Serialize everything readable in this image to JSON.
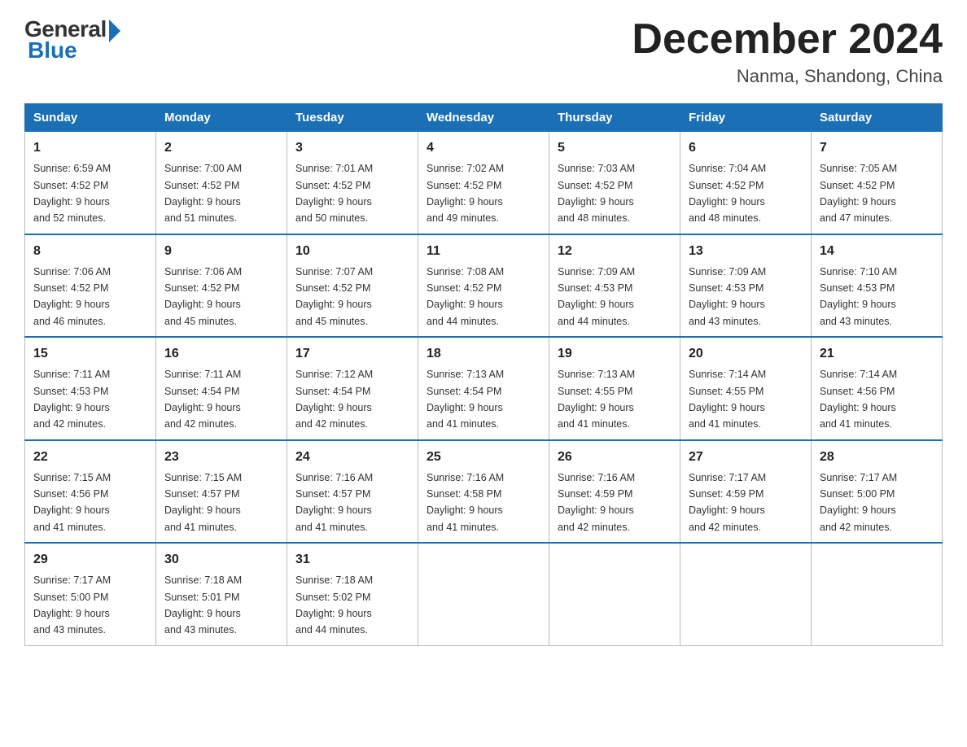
{
  "header": {
    "logo_general": "General",
    "logo_blue": "Blue",
    "month_title": "December 2024",
    "location": "Nanma, Shandong, China"
  },
  "weekdays": [
    "Sunday",
    "Monday",
    "Tuesday",
    "Wednesday",
    "Thursday",
    "Friday",
    "Saturday"
  ],
  "weeks": [
    [
      {
        "day": "1",
        "sunrise": "6:59 AM",
        "sunset": "4:52 PM",
        "daylight": "9 hours and 52 minutes."
      },
      {
        "day": "2",
        "sunrise": "7:00 AM",
        "sunset": "4:52 PM",
        "daylight": "9 hours and 51 minutes."
      },
      {
        "day": "3",
        "sunrise": "7:01 AM",
        "sunset": "4:52 PM",
        "daylight": "9 hours and 50 minutes."
      },
      {
        "day": "4",
        "sunrise": "7:02 AM",
        "sunset": "4:52 PM",
        "daylight": "9 hours and 49 minutes."
      },
      {
        "day": "5",
        "sunrise": "7:03 AM",
        "sunset": "4:52 PM",
        "daylight": "9 hours and 48 minutes."
      },
      {
        "day": "6",
        "sunrise": "7:04 AM",
        "sunset": "4:52 PM",
        "daylight": "9 hours and 48 minutes."
      },
      {
        "day": "7",
        "sunrise": "7:05 AM",
        "sunset": "4:52 PM",
        "daylight": "9 hours and 47 minutes."
      }
    ],
    [
      {
        "day": "8",
        "sunrise": "7:06 AM",
        "sunset": "4:52 PM",
        "daylight": "9 hours and 46 minutes."
      },
      {
        "day": "9",
        "sunrise": "7:06 AM",
        "sunset": "4:52 PM",
        "daylight": "9 hours and 45 minutes."
      },
      {
        "day": "10",
        "sunrise": "7:07 AM",
        "sunset": "4:52 PM",
        "daylight": "9 hours and 45 minutes."
      },
      {
        "day": "11",
        "sunrise": "7:08 AM",
        "sunset": "4:52 PM",
        "daylight": "9 hours and 44 minutes."
      },
      {
        "day": "12",
        "sunrise": "7:09 AM",
        "sunset": "4:53 PM",
        "daylight": "9 hours and 44 minutes."
      },
      {
        "day": "13",
        "sunrise": "7:09 AM",
        "sunset": "4:53 PM",
        "daylight": "9 hours and 43 minutes."
      },
      {
        "day": "14",
        "sunrise": "7:10 AM",
        "sunset": "4:53 PM",
        "daylight": "9 hours and 43 minutes."
      }
    ],
    [
      {
        "day": "15",
        "sunrise": "7:11 AM",
        "sunset": "4:53 PM",
        "daylight": "9 hours and 42 minutes."
      },
      {
        "day": "16",
        "sunrise": "7:11 AM",
        "sunset": "4:54 PM",
        "daylight": "9 hours and 42 minutes."
      },
      {
        "day": "17",
        "sunrise": "7:12 AM",
        "sunset": "4:54 PM",
        "daylight": "9 hours and 42 minutes."
      },
      {
        "day": "18",
        "sunrise": "7:13 AM",
        "sunset": "4:54 PM",
        "daylight": "9 hours and 41 minutes."
      },
      {
        "day": "19",
        "sunrise": "7:13 AM",
        "sunset": "4:55 PM",
        "daylight": "9 hours and 41 minutes."
      },
      {
        "day": "20",
        "sunrise": "7:14 AM",
        "sunset": "4:55 PM",
        "daylight": "9 hours and 41 minutes."
      },
      {
        "day": "21",
        "sunrise": "7:14 AM",
        "sunset": "4:56 PM",
        "daylight": "9 hours and 41 minutes."
      }
    ],
    [
      {
        "day": "22",
        "sunrise": "7:15 AM",
        "sunset": "4:56 PM",
        "daylight": "9 hours and 41 minutes."
      },
      {
        "day": "23",
        "sunrise": "7:15 AM",
        "sunset": "4:57 PM",
        "daylight": "9 hours and 41 minutes."
      },
      {
        "day": "24",
        "sunrise": "7:16 AM",
        "sunset": "4:57 PM",
        "daylight": "9 hours and 41 minutes."
      },
      {
        "day": "25",
        "sunrise": "7:16 AM",
        "sunset": "4:58 PM",
        "daylight": "9 hours and 41 minutes."
      },
      {
        "day": "26",
        "sunrise": "7:16 AM",
        "sunset": "4:59 PM",
        "daylight": "9 hours and 42 minutes."
      },
      {
        "day": "27",
        "sunrise": "7:17 AM",
        "sunset": "4:59 PM",
        "daylight": "9 hours and 42 minutes."
      },
      {
        "day": "28",
        "sunrise": "7:17 AM",
        "sunset": "5:00 PM",
        "daylight": "9 hours and 42 minutes."
      }
    ],
    [
      {
        "day": "29",
        "sunrise": "7:17 AM",
        "sunset": "5:00 PM",
        "daylight": "9 hours and 43 minutes."
      },
      {
        "day": "30",
        "sunrise": "7:18 AM",
        "sunset": "5:01 PM",
        "daylight": "9 hours and 43 minutes."
      },
      {
        "day": "31",
        "sunrise": "7:18 AM",
        "sunset": "5:02 PM",
        "daylight": "9 hours and 44 minutes."
      },
      null,
      null,
      null,
      null
    ]
  ],
  "labels": {
    "sunrise": "Sunrise: ",
    "sunset": "Sunset: ",
    "daylight": "Daylight: "
  }
}
